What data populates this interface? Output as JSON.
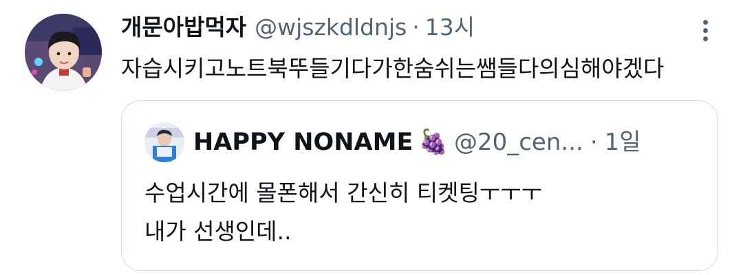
{
  "tweet": {
    "author_name": "개문아밥먹자",
    "handle": "@wjszkdldnjs",
    "separator": "·",
    "time": "13시",
    "text": "자습시키고노트북뚜들기다가한숨쉬는쌤들다의심해야겠다"
  },
  "quote": {
    "author_name": "HAPPY NONAME",
    "emoji": "🍇",
    "handle": "@20_cen...",
    "separator": "·",
    "time": "1일",
    "text_line1": "수업시간에 몰폰해서 간신히 티켓팅ㅜㅜㅜ",
    "text_line2": "내가 선생인데.."
  },
  "icons": {
    "more": "more-vertical-icon",
    "grapes": "grapes-icon"
  }
}
